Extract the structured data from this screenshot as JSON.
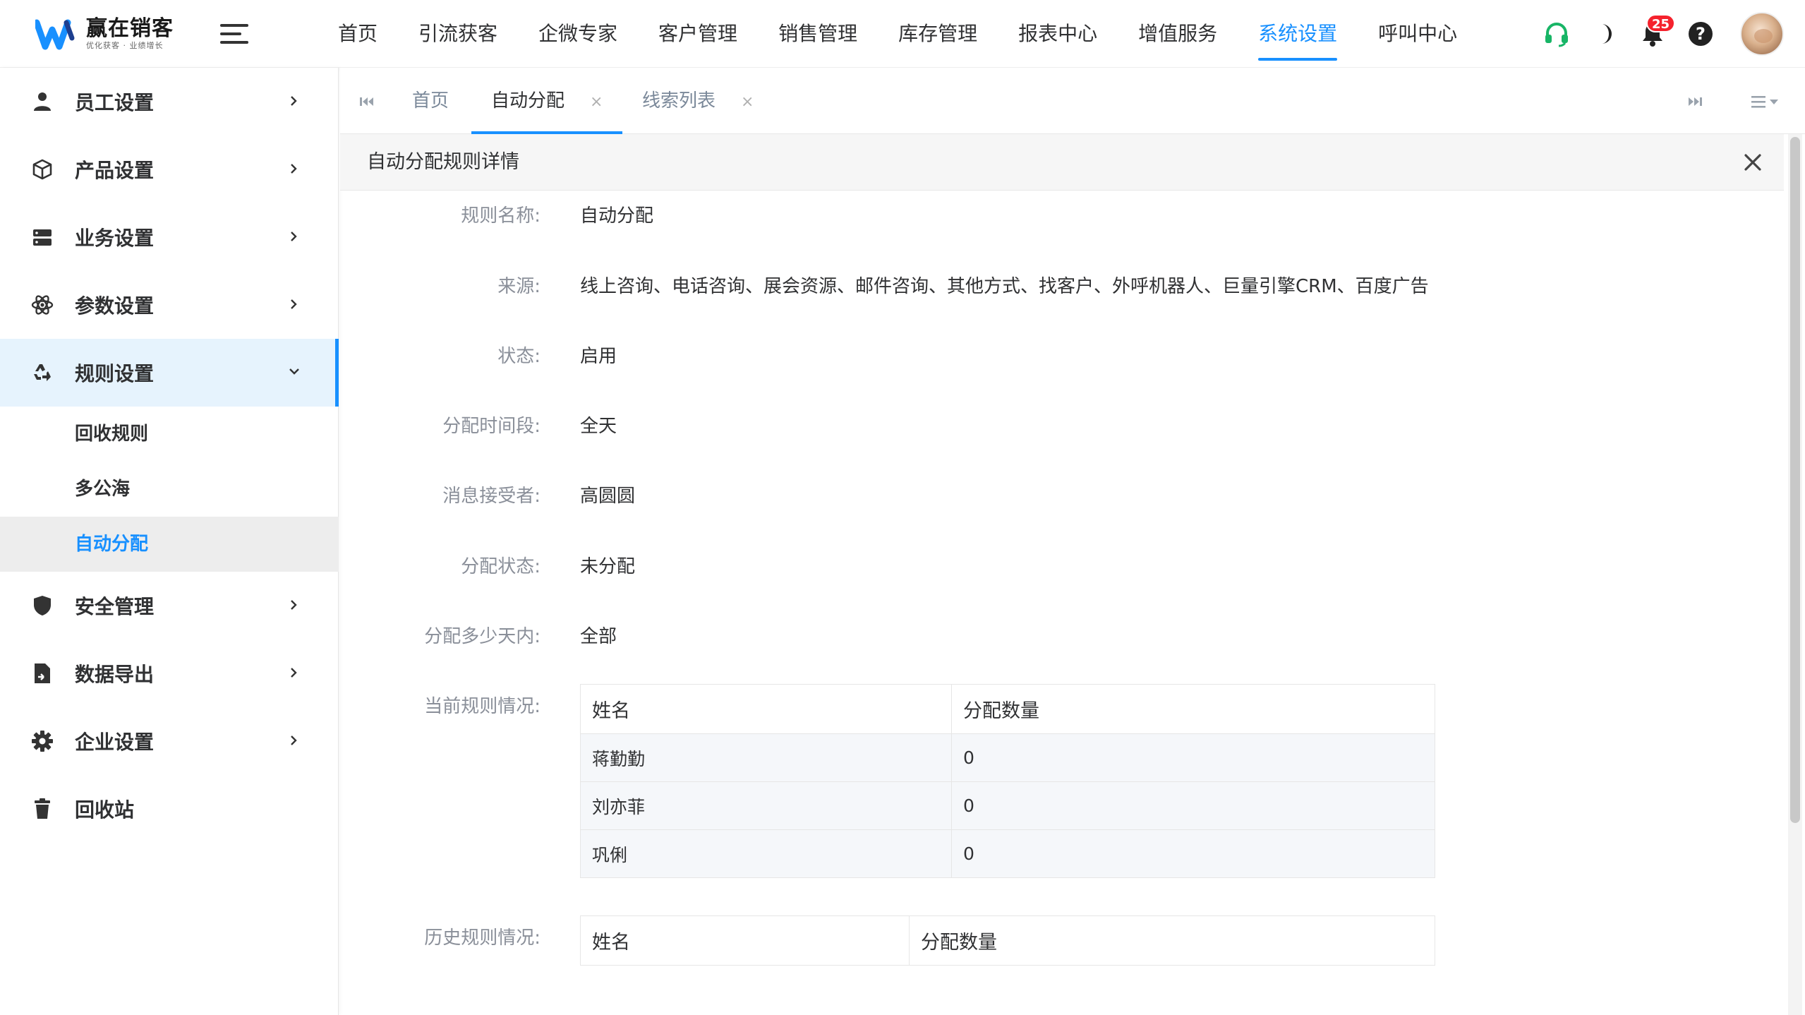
{
  "app": {
    "logo_title": "赢在销客",
    "logo_subtitle": "优化获客 · 业绩增长"
  },
  "nav": {
    "items": [
      "首页",
      "引流获客",
      "企微专家",
      "客户管理",
      "销售管理",
      "库存管理",
      "报表中心",
      "增值服务",
      "系统设置",
      "呼叫中心"
    ],
    "active": "系统设置"
  },
  "header_tools": {
    "icons": [
      "headset-icon",
      "moon-icon",
      "bell-icon",
      "help-icon"
    ],
    "notification_count": "25"
  },
  "sidebar": {
    "items": [
      {
        "label": "员工设置",
        "icon": "user-icon"
      },
      {
        "label": "产品设置",
        "icon": "cube-icon"
      },
      {
        "label": "业务设置",
        "icon": "server-icon"
      },
      {
        "label": "参数设置",
        "icon": "atom-icon"
      },
      {
        "label": "规则设置",
        "icon": "recycle-icon"
      },
      {
        "label": "安全管理",
        "icon": "shield-icon"
      },
      {
        "label": "数据导出",
        "icon": "file-export-icon"
      },
      {
        "label": "企业设置",
        "icon": "gear-icon"
      },
      {
        "label": "回收站",
        "icon": "trash-icon"
      }
    ],
    "submenu": [
      "回收规则",
      "多公海",
      "自动分配"
    ],
    "active_sub": "自动分配"
  },
  "tabs": [
    {
      "label": "首页",
      "closable": false,
      "active": false
    },
    {
      "label": "自动分配",
      "closable": true,
      "active": true
    },
    {
      "label": "线索列表",
      "closable": true,
      "active": false
    }
  ],
  "tab_close_glyph": "×",
  "panel": {
    "title": "自动分配规则详情",
    "fields": [
      {
        "label": "规则名称:",
        "value": "自动分配"
      },
      {
        "label": "来源:",
        "value": "线上咨询、电话咨询、展会资源、邮件咨询、其他方式、找客户、外呼机器人、巨量引擎CRM、百度广告"
      },
      {
        "label": "状态:",
        "value": "启用"
      },
      {
        "label": "分配时间段:",
        "value": "全天"
      },
      {
        "label": "消息接受者:",
        "value": "高圆圆"
      },
      {
        "label": "分配状态:",
        "value": "未分配"
      },
      {
        "label": "分配多少天内:",
        "value": "全部"
      }
    ],
    "current_rules": {
      "label": "当前规则情况:",
      "columns": [
        "姓名",
        "分配数量"
      ],
      "rows": [
        [
          "蒋勤勤",
          "0"
        ],
        [
          "刘亦菲",
          "0"
        ],
        [
          "巩俐",
          "0"
        ]
      ]
    },
    "history_rules": {
      "label": "历史规则情况:",
      "columns": [
        "姓名",
        "分配数量"
      ],
      "rows": []
    }
  },
  "colors": {
    "accent": "#1890ff",
    "sidebar_open_bg": "#e6f3fd",
    "sub_active_bg": "#ededed",
    "badge": "#f5222d",
    "headset": "#18b566"
  }
}
